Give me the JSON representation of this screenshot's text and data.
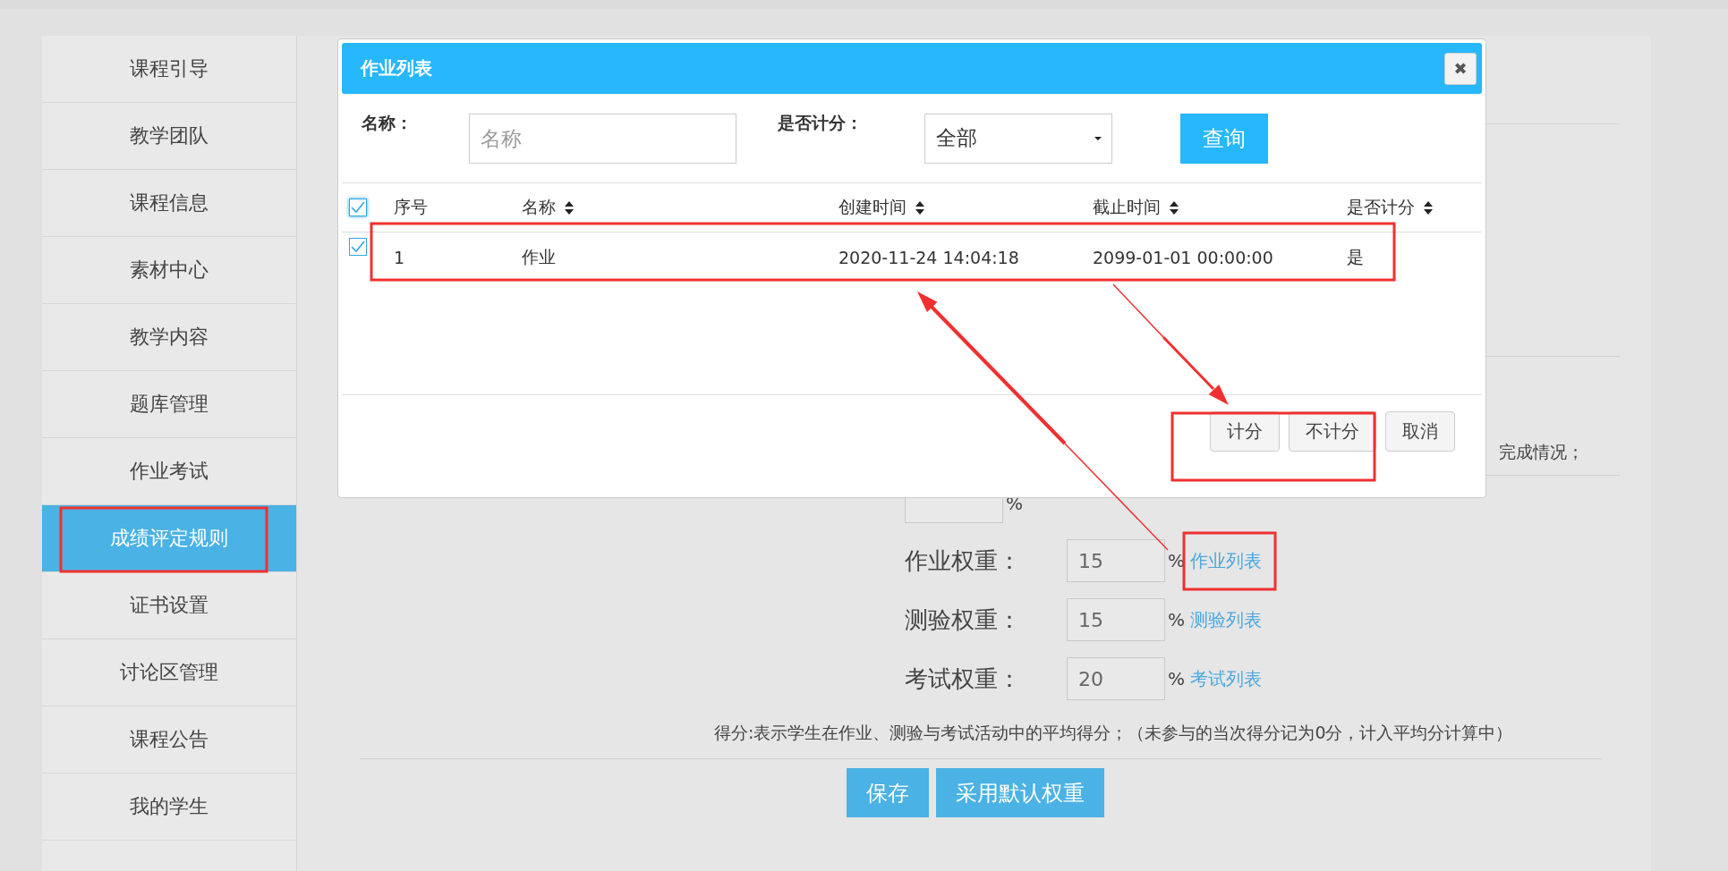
{
  "sidebar": {
    "items": [
      {
        "label": "课程引导",
        "selected": false
      },
      {
        "label": "教学团队",
        "selected": false
      },
      {
        "label": "课程信息",
        "selected": false
      },
      {
        "label": "素材中心",
        "selected": false
      },
      {
        "label": "教学内容",
        "selected": false
      },
      {
        "label": "题库管理",
        "selected": false
      },
      {
        "label": "作业考试",
        "selected": false
      },
      {
        "label": "成绩评定规则",
        "selected": true
      },
      {
        "label": "证书设置",
        "selected": false
      },
      {
        "label": "讨论区管理",
        "selected": false
      },
      {
        "label": "课程公告",
        "selected": false
      },
      {
        "label": "我的学生",
        "selected": false
      }
    ]
  },
  "form": {
    "note_tail": "完成情况；",
    "score_weight": {
      "unit": "%"
    },
    "weights": [
      {
        "label": "作业权重：",
        "value": "15",
        "unit": "%",
        "link": "作业列表"
      },
      {
        "label": "测验权重：",
        "value": "15",
        "unit": "%",
        "link": "测验列表"
      },
      {
        "label": "考试权重：",
        "value": "20",
        "unit": "%",
        "link": "考试列表"
      }
    ],
    "note": "得分:表示学生在作业、测验与考试活动中的平均得分；（未参与的当次得分记为0分，计入平均分计算中）",
    "buttons": [
      "保存",
      "采用默认权重"
    ]
  },
  "dialog": {
    "title": "作业列表",
    "close": "✖",
    "filters": {
      "name_label": "名称：",
      "name_placeholder": "名称",
      "scored_label": "是否计分：",
      "scored_value": "全部",
      "query_button": "查询"
    },
    "table": {
      "all_checked": true,
      "columns": [
        {
          "label": "序号",
          "sortable": false
        },
        {
          "label": "名称",
          "sortable": true
        },
        {
          "label": "创建时间",
          "sortable": true
        },
        {
          "label": "截止时间",
          "sortable": true
        },
        {
          "label": "是否计分",
          "sortable": true
        }
      ],
      "rows": [
        {
          "checked": true,
          "cells": [
            "1",
            "作业",
            "2020-11-24 14:04:18",
            "2099-01-01 00:00:00",
            "是"
          ]
        }
      ]
    },
    "buttons": [
      "计分",
      "不计分",
      "取消"
    ]
  }
}
